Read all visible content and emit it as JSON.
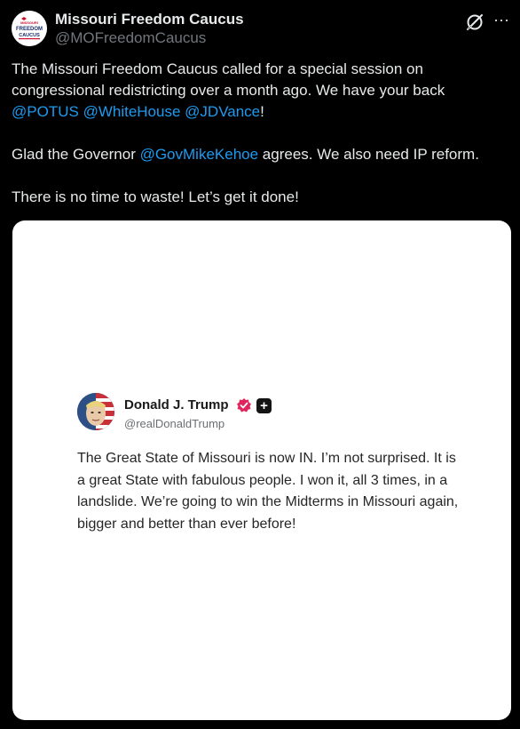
{
  "post": {
    "author_name": "Missouri Freedom Caucus",
    "author_handle": "@MOFreedomCaucus",
    "avatar_text": [
      "MISSOURI",
      "FREEDOM",
      "CAUCUS"
    ],
    "grok_icon": "grok-icon",
    "more_icon": "more-icon",
    "more_label": "···",
    "paragraph1": {
      "text": "The Missouri Freedom Caucus called for a special session on congressional redistricting over a month ago. We have your back ",
      "mentions": [
        "@POTUS",
        "@WhiteHouse",
        "@JDVance"
      ],
      "tail": "!"
    },
    "paragraph2": {
      "lead": "Glad the Governor ",
      "mention": "@GovMikeKehoe",
      "tail": " agrees. We also need IP reform."
    },
    "paragraph3": "There is no time to waste! Let’s get it done!",
    "colors": {
      "background": "#000000",
      "text": "#e7e9ea",
      "secondary": "#71767b",
      "mention": "#1d9bf0"
    }
  },
  "quoted_post": {
    "author_name": "Donald J. Trump",
    "author_handle": "@realDonaldTrump",
    "verified_icon": "verified-badge-icon",
    "plus_icon": "plus-badge-icon",
    "plus_label": "+",
    "text": "The Great State of Missouri is now IN. I’m not surprised. It is a great State with fabulous people. I won it, all 3 times, in a landslide. We’re going to win the Midterms in Missouri again, bigger and better than ever before!",
    "colors": {
      "card_background": "#ffffff",
      "name": "#1a1a1a",
      "handle": "#6b6f73",
      "verified": "#e0245e"
    }
  }
}
